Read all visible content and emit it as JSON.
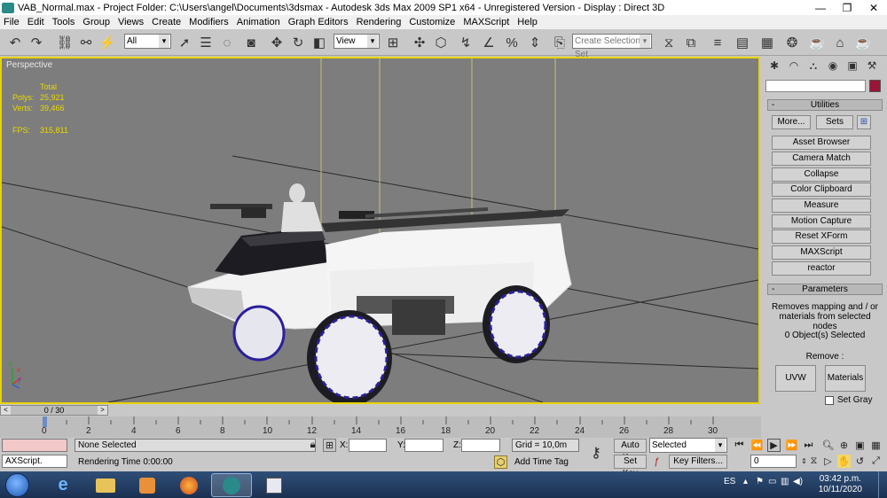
{
  "window": {
    "title": "VAB_Normal.max    - Project Folder: C:\\Users\\angel\\Documents\\3dsmax    - Autodesk 3ds Max  2009 SP1  x64    - Unregistered Version    - Display : Direct 3D",
    "minimize": "—",
    "restore": "❐",
    "close": "✕"
  },
  "menu": [
    "File",
    "Edit",
    "Tools",
    "Group",
    "Views",
    "Create",
    "Modifiers",
    "Animation",
    "Graph Editors",
    "Rendering",
    "Customize",
    "MAXScript",
    "Help"
  ],
  "toolbar": {
    "filter_value": "All",
    "refcoord_value": "View",
    "selection_set_placeholder": "Create Selection Set"
  },
  "viewport": {
    "label": "Perspective",
    "stats": {
      "header": "Total",
      "polys_label": "Polys:",
      "polys_value": "25,921",
      "verts_label": "Verts:",
      "verts_value": "39,466",
      "fps_label": "FPS:",
      "fps_value": "315,811"
    },
    "axis_labels": {
      "x": "x",
      "y": "y",
      "z": "z"
    }
  },
  "command_panel": {
    "utilities_title": "Utilities",
    "more_button": "More...",
    "sets_button": "Sets",
    "utility_buttons": [
      "Asset Browser",
      "Camera Match",
      "Collapse",
      "Color Clipboard",
      "Measure",
      "Motion Capture",
      "Reset XForm",
      "MAXScript",
      "reactor"
    ],
    "parameters_title": "Parameters",
    "description": "Removes mapping and / or materials from selected nodes",
    "selected_count": "0 Object(s) Selected",
    "remove_label": "Remove :",
    "uvw_button": "UVW",
    "materials_button": "Materials",
    "set_gray_label": "Set Gray",
    "colors": {
      "name_swatch": "#9a1538"
    }
  },
  "timeline": {
    "slider_text": "0 / 30",
    "ticks": [
      "0",
      "2",
      "4",
      "6",
      "8",
      "10",
      "12",
      "14",
      "16",
      "18",
      "20",
      "22",
      "24",
      "26",
      "28",
      "30"
    ]
  },
  "status": {
    "maxscript_label": "AXScript.",
    "selection_text": "None Selected",
    "rendering_text": "Rendering Time  0:00:00",
    "x_label": "X:",
    "y_label": "Y:",
    "z_label": "Z:",
    "grid_text": "Grid = 10,0m",
    "add_time_tag": "Add Time Tag",
    "auto_key": "Auto Key",
    "set_key": "Set Key",
    "key_mode_value": "Selected",
    "key_filters": "Key Filters...",
    "frame_value": "0"
  },
  "taskbar": {
    "lang": "ES",
    "time": "03:42 p.m.",
    "date": "10/11/2020"
  }
}
